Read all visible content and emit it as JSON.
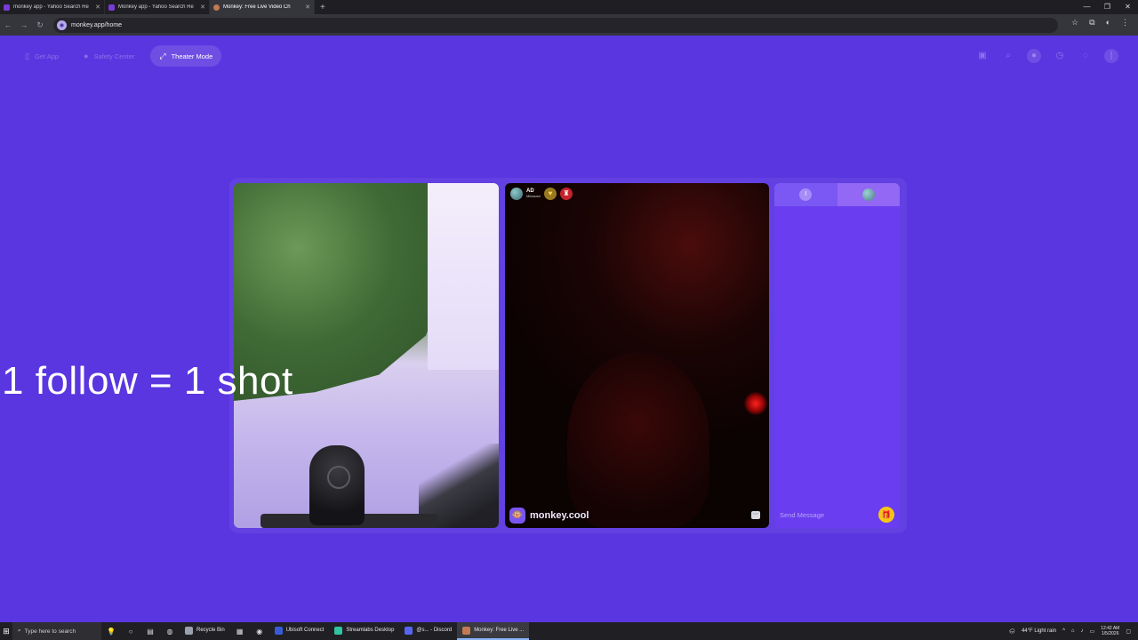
{
  "browser": {
    "tabs": [
      {
        "title": "monkey app - Yahoo Search Re",
        "active": false
      },
      {
        "title": "Monkey app - Yahoo Search Re",
        "active": false
      },
      {
        "title": "Monkey: Free Live Video Ch",
        "active": true
      }
    ],
    "url": "monkey.app/home"
  },
  "nav": {
    "get_app": "Get App",
    "safety_center": "Safety Center",
    "theater_mode": "Theater Mode"
  },
  "overlay_text": "1 follow = 1 shot",
  "peer": {
    "initials": "AD",
    "subtitle": "Mikasam",
    "watermark": "monkey.cool"
  },
  "chat": {
    "placeholder": "Send Message",
    "left_initial": "I"
  },
  "taskbar": {
    "search_placeholder": "Type here to search",
    "apps": [
      {
        "label": "Recycle Bin",
        "color": "#9aa0ad"
      },
      {
        "label": "Ubisoft Connect",
        "color": "#3b5bd6"
      },
      {
        "label": "Streamlabs Desktop",
        "color": "#31c3a2"
      },
      {
        "label": "@s... - Discord",
        "color": "#5865f2"
      },
      {
        "label": "Monkey: Free Live ...",
        "color": "#c47a52"
      }
    ],
    "weather": "44°F  Light rain",
    "time": "12:42 AM",
    "date": "1/5/2026"
  }
}
